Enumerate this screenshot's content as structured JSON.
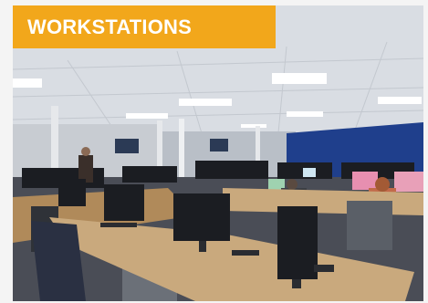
{
  "caption": {
    "text": "WORKSTATIONS",
    "background_color": "#f2a71b",
    "text_color": "#ffffff"
  },
  "photo": {
    "colors": {
      "ceiling": "#d9dde3",
      "back_wall_blue": "#1f3f8c",
      "side_wall": "#c8ccd2",
      "carpet": "#4a4d56",
      "desk_wood": "#c9a97d",
      "monitor": "#1b1d22"
    }
  }
}
